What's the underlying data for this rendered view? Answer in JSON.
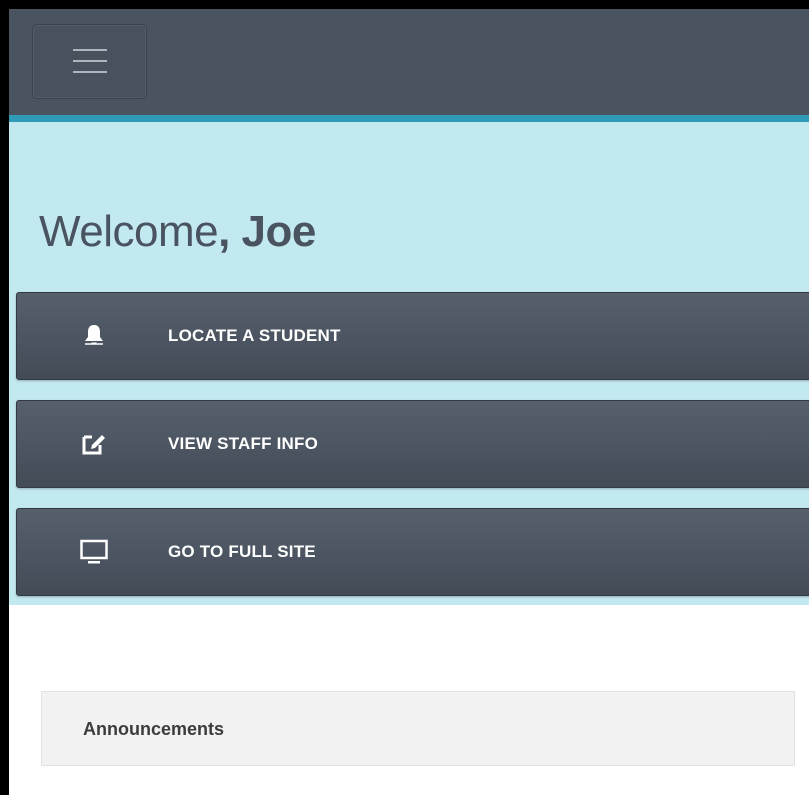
{
  "header": {
    "menu_icon": "hamburger-menu-icon",
    "accent_color": "#2f9bb8",
    "background_color": "#4a5360"
  },
  "welcome": {
    "greeting": "Welcome",
    "comma": ",",
    "name": "Joe"
  },
  "nav": [
    {
      "label": "LOCATE A STUDENT",
      "icon": "bell-icon"
    },
    {
      "label": "VIEW STAFF INFO",
      "icon": "edit-icon"
    },
    {
      "label": "GO TO FULL SITE",
      "icon": "monitor-icon"
    }
  ],
  "announcements": {
    "title": "Announcements"
  }
}
